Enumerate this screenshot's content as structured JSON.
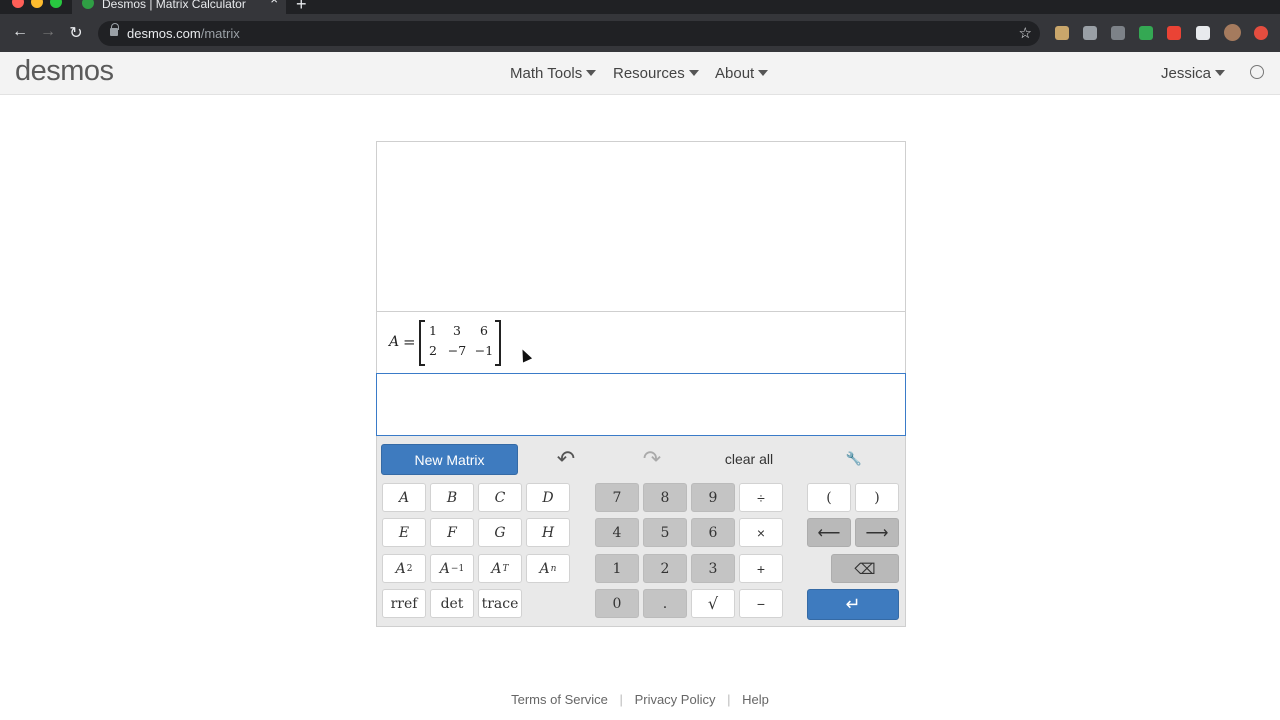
{
  "browser": {
    "tab_title": "Desmos | Matrix Calculator",
    "tab_close": "×",
    "new_tab": "+",
    "url_host": "desmos.com",
    "url_path": "/matrix",
    "back": "←",
    "forward": "→",
    "reload": "↻",
    "star": "☆"
  },
  "header": {
    "logo": "desmos",
    "nav": [
      "Math Tools",
      "Resources",
      "About"
    ],
    "user": "Jessica"
  },
  "expression": {
    "variable": "A",
    "equals": "=",
    "matrix": [
      [
        "1",
        "3",
        "6"
      ],
      [
        "2",
        "−7",
        "−1"
      ]
    ]
  },
  "keypad": {
    "new_matrix": "New Matrix",
    "undo": "↶",
    "redo": "↷",
    "clear_all": "clear all",
    "settings": "🔧",
    "letters": [
      "A",
      "B",
      "C",
      "D",
      "E",
      "F",
      "G",
      "H"
    ],
    "powers": [
      {
        "base": "A",
        "exp": "2"
      },
      {
        "base": "A",
        "exp": "−1"
      },
      {
        "base": "A",
        "exp": "T"
      },
      {
        "base": "A",
        "exp": "n"
      }
    ],
    "functions": [
      "rref",
      "det",
      "trace"
    ],
    "digits": [
      "7",
      "8",
      "9",
      "4",
      "5",
      "6",
      "1",
      "2",
      "3",
      "0",
      "."
    ],
    "sqrt": "√",
    "operators": [
      "÷",
      "×",
      "+",
      "−"
    ],
    "parens": [
      "(",
      ")"
    ],
    "left_arrow": "⟵",
    "right_arrow": "⟶",
    "backspace": "⌫",
    "enter": "↵"
  },
  "footer": {
    "links": [
      "Terms of Service",
      "Privacy Policy",
      "Help"
    ],
    "separator": "|"
  },
  "colors": {
    "accent": "#3e7bbf",
    "header_bg": "#f3f3f3",
    "keypad_bg": "#e9e9e9"
  }
}
